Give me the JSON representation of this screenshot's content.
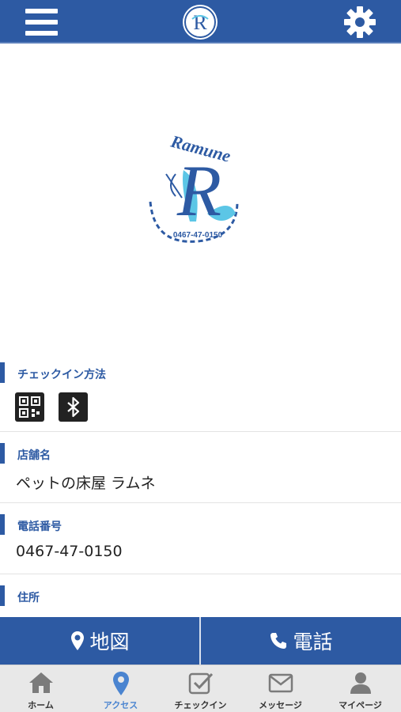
{
  "header": {
    "menu_icon": "hamburger-menu-icon",
    "logo_icon": "app-logo-icon",
    "settings_icon": "gear-icon"
  },
  "store_logo": {
    "text": "Ramune",
    "phone_text": "0467-47-0150",
    "colors": {
      "blue": "#2d5aa3",
      "aqua": "#5cc6e6"
    }
  },
  "sections": {
    "checkin": {
      "title": "チェックイン方法",
      "icons": [
        "qr-code-icon",
        "bluetooth-icon"
      ]
    },
    "store_name": {
      "title": "店舗名",
      "value": "ペットの床屋 ラムネ"
    },
    "phone": {
      "title": "電話番号",
      "value": "0467-47-0150"
    },
    "address": {
      "title": "住所"
    }
  },
  "actions": {
    "map_label": "地図",
    "phone_label": "電話"
  },
  "tabs": [
    {
      "label": "ホーム",
      "icon": "home-icon",
      "active": false
    },
    {
      "label": "アクセス",
      "icon": "map-pin-icon",
      "active": true
    },
    {
      "label": "チェックイン",
      "icon": "checkin-icon",
      "active": false
    },
    {
      "label": "メッセージ",
      "icon": "envelope-icon",
      "active": false
    },
    {
      "label": "マイページ",
      "icon": "user-icon",
      "active": false
    }
  ],
  "colors": {
    "primary": "#2d5aa3",
    "tab_active": "#4a84d0",
    "tab_bg": "#e8e8e8"
  }
}
